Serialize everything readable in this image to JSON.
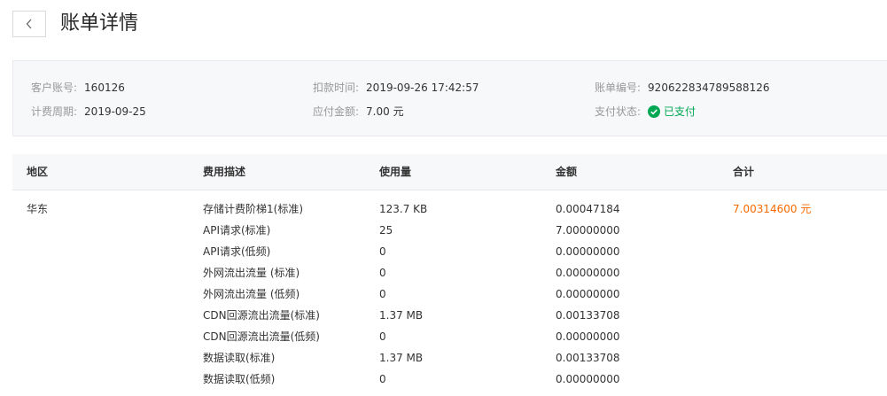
{
  "header": {
    "back_icon": "chevron-left-icon",
    "title": "账单详情"
  },
  "summary": {
    "customer_account": {
      "label": "客户账号:",
      "value": "160126"
    },
    "deduct_time": {
      "label": "扣款时间:",
      "value": "2019-09-26 17:42:57"
    },
    "bill_number": {
      "label": "账单编号:",
      "value": "920622834789588126"
    },
    "billing_period": {
      "label": "计费周期:",
      "value": "2019-09-25"
    },
    "amount_payable": {
      "label": "应付金额:",
      "value": "7.00 元"
    },
    "payment_status": {
      "label": "支付状态:",
      "value": "已支付",
      "icon": "check-circle-icon",
      "color": "#00a854"
    }
  },
  "table": {
    "headers": [
      "地区",
      "费用描述",
      "使用量",
      "金额",
      "合计"
    ],
    "region": "华东",
    "total": "7.00314600 元",
    "total_color": "#f56a00",
    "rows": [
      {
        "desc": "存储计费阶梯1(标准)",
        "usage": "123.7 KB",
        "amount": "0.00047184"
      },
      {
        "desc": "API请求(标准)",
        "usage": "25",
        "amount": "7.00000000"
      },
      {
        "desc": "API请求(低频)",
        "usage": "0",
        "amount": "0.00000000"
      },
      {
        "desc": "外网流出流量 (标准)",
        "usage": "0",
        "amount": "0.00000000"
      },
      {
        "desc": "外网流出流量 (低频)",
        "usage": "0",
        "amount": "0.00000000"
      },
      {
        "desc": "CDN回源流出流量(标准)",
        "usage": "1.37 MB",
        "amount": "0.00133708"
      },
      {
        "desc": "CDN回源流出流量(低频)",
        "usage": "0",
        "amount": "0.00000000"
      },
      {
        "desc": "数据读取(标准)",
        "usage": "1.37 MB",
        "amount": "0.00133708"
      },
      {
        "desc": "数据读取(低频)",
        "usage": "0",
        "amount": "0.00000000"
      }
    ]
  }
}
